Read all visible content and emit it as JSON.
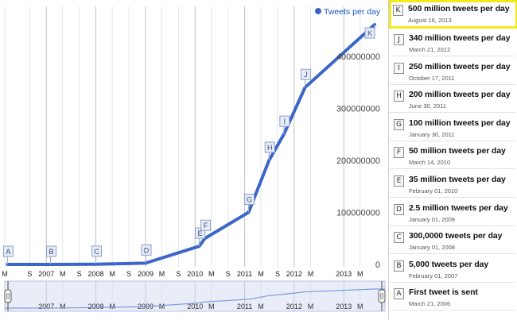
{
  "colors": {
    "series": "#3b66c9",
    "series_light": "#7e9be0",
    "selection_fill": "#e8edf8",
    "highlight": "#f3ea1d"
  },
  "chart_data": {
    "type": "line",
    "legend": {
      "label": "Tweets per day",
      "position": "top-right"
    },
    "ylim": [
      0,
      470000000
    ],
    "y_ticks": [
      {
        "value": 0,
        "label": "0"
      },
      {
        "value": 100000000,
        "label": "100000000"
      },
      {
        "value": 200000000,
        "label": "200000000"
      },
      {
        "value": 300000000,
        "label": "300000000"
      },
      {
        "value": 400000000,
        "label": "400000000"
      }
    ],
    "x_axis": {
      "range": [
        "2006-03-01",
        "2013-10-31"
      ],
      "tick_labels": [
        {
          "date": "2006-03-01",
          "label": "M"
        },
        {
          "date": "2006-09-01",
          "label": "S"
        },
        {
          "date": "2007-01-01",
          "label": "2007"
        },
        {
          "date": "2007-05-01",
          "label": "M"
        },
        {
          "date": "2007-09-01",
          "label": "S"
        },
        {
          "date": "2008-01-01",
          "label": "2008"
        },
        {
          "date": "2008-05-01",
          "label": "M"
        },
        {
          "date": "2008-09-01",
          "label": "S"
        },
        {
          "date": "2009-01-01",
          "label": "2009"
        },
        {
          "date": "2009-05-01",
          "label": "M"
        },
        {
          "date": "2009-09-01",
          "label": "S"
        },
        {
          "date": "2010-01-01",
          "label": "2010"
        },
        {
          "date": "2010-05-01",
          "label": "M"
        },
        {
          "date": "2010-09-01",
          "label": "S"
        },
        {
          "date": "2011-01-01",
          "label": "2011"
        },
        {
          "date": "2011-05-01",
          "label": "M"
        },
        {
          "date": "2011-09-01",
          "label": "S"
        },
        {
          "date": "2012-01-01",
          "label": "2012"
        },
        {
          "date": "2012-05-01",
          "label": "M"
        },
        {
          "date": "2013-01-01",
          "label": "2013"
        },
        {
          "date": "2013-05-01",
          "label": "M"
        }
      ]
    },
    "grid": true,
    "series": [
      {
        "name": "Tweets per day",
        "points": [
          {
            "x": "2006-03-21",
            "y": 0
          },
          {
            "x": "2007-02-01",
            "y": 5000
          },
          {
            "x": "2008-01-01",
            "y": 300000
          },
          {
            "x": "2009-01-01",
            "y": 2500000
          },
          {
            "x": "2010-02-01",
            "y": 35000000
          },
          {
            "x": "2010-03-14",
            "y": 50000000
          },
          {
            "x": "2011-01-30",
            "y": 100000000
          },
          {
            "x": "2011-06-30",
            "y": 200000000
          },
          {
            "x": "2011-10-17",
            "y": 250000000
          },
          {
            "x": "2012-03-21",
            "y": 340000000
          },
          {
            "x": "2013-08-16",
            "y": 500000000
          }
        ]
      }
    ],
    "annotations": [
      {
        "letter": "A",
        "x": "2006-03-21",
        "y": 0
      },
      {
        "letter": "B",
        "x": "2007-02-01",
        "y": 5000
      },
      {
        "letter": "C",
        "x": "2008-01-01",
        "y": 300000
      },
      {
        "letter": "D",
        "x": "2009-01-01",
        "y": 2500000
      },
      {
        "letter": "E",
        "x": "2010-02-01",
        "y": 35000000
      },
      {
        "letter": "F",
        "x": "2010-03-14",
        "y": 50000000
      },
      {
        "letter": "G",
        "x": "2011-01-30",
        "y": 100000000
      },
      {
        "letter": "H",
        "x": "2011-06-30",
        "y": 200000000
      },
      {
        "letter": "I",
        "x": "2011-10-17",
        "y": 250000000
      },
      {
        "letter": "J",
        "x": "2012-03-21",
        "y": 340000000
      },
      {
        "letter": "K",
        "x": "2013-08-16",
        "y": 500000000
      }
    ],
    "range_selector": {
      "tick_labels": [
        {
          "date": "2007-01-01",
          "label": "2007"
        },
        {
          "date": "2007-05-01",
          "label": "M"
        },
        {
          "date": "2008-01-01",
          "label": "2008"
        },
        {
          "date": "2008-05-01",
          "label": "M"
        },
        {
          "date": "2009-01-01",
          "label": "2009"
        },
        {
          "date": "2009-05-01",
          "label": "M"
        },
        {
          "date": "2010-01-01",
          "label": "2010"
        },
        {
          "date": "2010-05-01",
          "label": "M"
        },
        {
          "date": "2011-01-01",
          "label": "2011"
        },
        {
          "date": "2011-05-01",
          "label": "M"
        },
        {
          "date": "2012-01-01",
          "label": "2012"
        },
        {
          "date": "2012-05-01",
          "label": "M"
        },
        {
          "date": "2013-01-01",
          "label": "2013"
        },
        {
          "date": "2013-05-01",
          "label": "M"
        }
      ]
    }
  },
  "sidebar": {
    "selected": "K",
    "items": [
      {
        "letter": "K",
        "title": "500 million tweets per day",
        "date": "August 16, 2013"
      },
      {
        "letter": "J",
        "title": "340 million tweets per day",
        "date": "March 21, 2012"
      },
      {
        "letter": "I",
        "title": "250 million tweets per day",
        "date": "October 17, 2011"
      },
      {
        "letter": "H",
        "title": "200 million tweets per day",
        "date": "June 30, 2011"
      },
      {
        "letter": "G",
        "title": "100 million tweets per day",
        "date": "January 30, 2011"
      },
      {
        "letter": "F",
        "title": "50 million tweets per day",
        "date": "March 14, 2010"
      },
      {
        "letter": "E",
        "title": "35 million tweets per day",
        "date": "February 01, 2010"
      },
      {
        "letter": "D",
        "title": "2.5 million tweets per day",
        "date": "January 01, 2009"
      },
      {
        "letter": "C",
        "title": "300,0000 tweets per day",
        "date": "January 01, 2008"
      },
      {
        "letter": "B",
        "title": "5,000 tweets per day",
        "date": "February 01, 2007"
      },
      {
        "letter": "A",
        "title": "First tweet is sent",
        "date": "March 21, 2006"
      }
    ]
  }
}
